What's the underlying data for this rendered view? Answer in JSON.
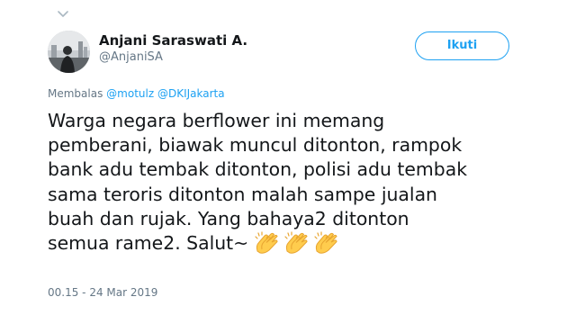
{
  "author": {
    "name": "Anjani Saraswati A.",
    "handle": "@AnjaniSA"
  },
  "follow_button": {
    "label": "Ikuti"
  },
  "reply": {
    "prefix": "Membalas",
    "mentions": [
      "@motulz",
      "@DKIJakarta"
    ]
  },
  "tweet": {
    "lines": [
      "Warga negara berflower ini memang",
      "pemberani, biawak muncul ditonton, rampok",
      "bank adu tembak ditonton, polisi adu tembak",
      "sama teroris ditonton malah sampe jualan",
      "buah dan rujak. Yang bahaya2 ditonton",
      "semua rame2. Salut~"
    ],
    "emoji": [
      "clapping-hands",
      "clapping-hands",
      "clapping-hands"
    ]
  },
  "timestamp": "00.15 - 24 Mar 2019",
  "colors": {
    "accent": "#1da1f2",
    "secondary_text": "#657786",
    "primary_text": "#14171a",
    "emoji_yellow": "#ffcc4d"
  },
  "icons": {
    "caret": "chevron-down-icon",
    "clap": "clapping-hands-icon"
  }
}
